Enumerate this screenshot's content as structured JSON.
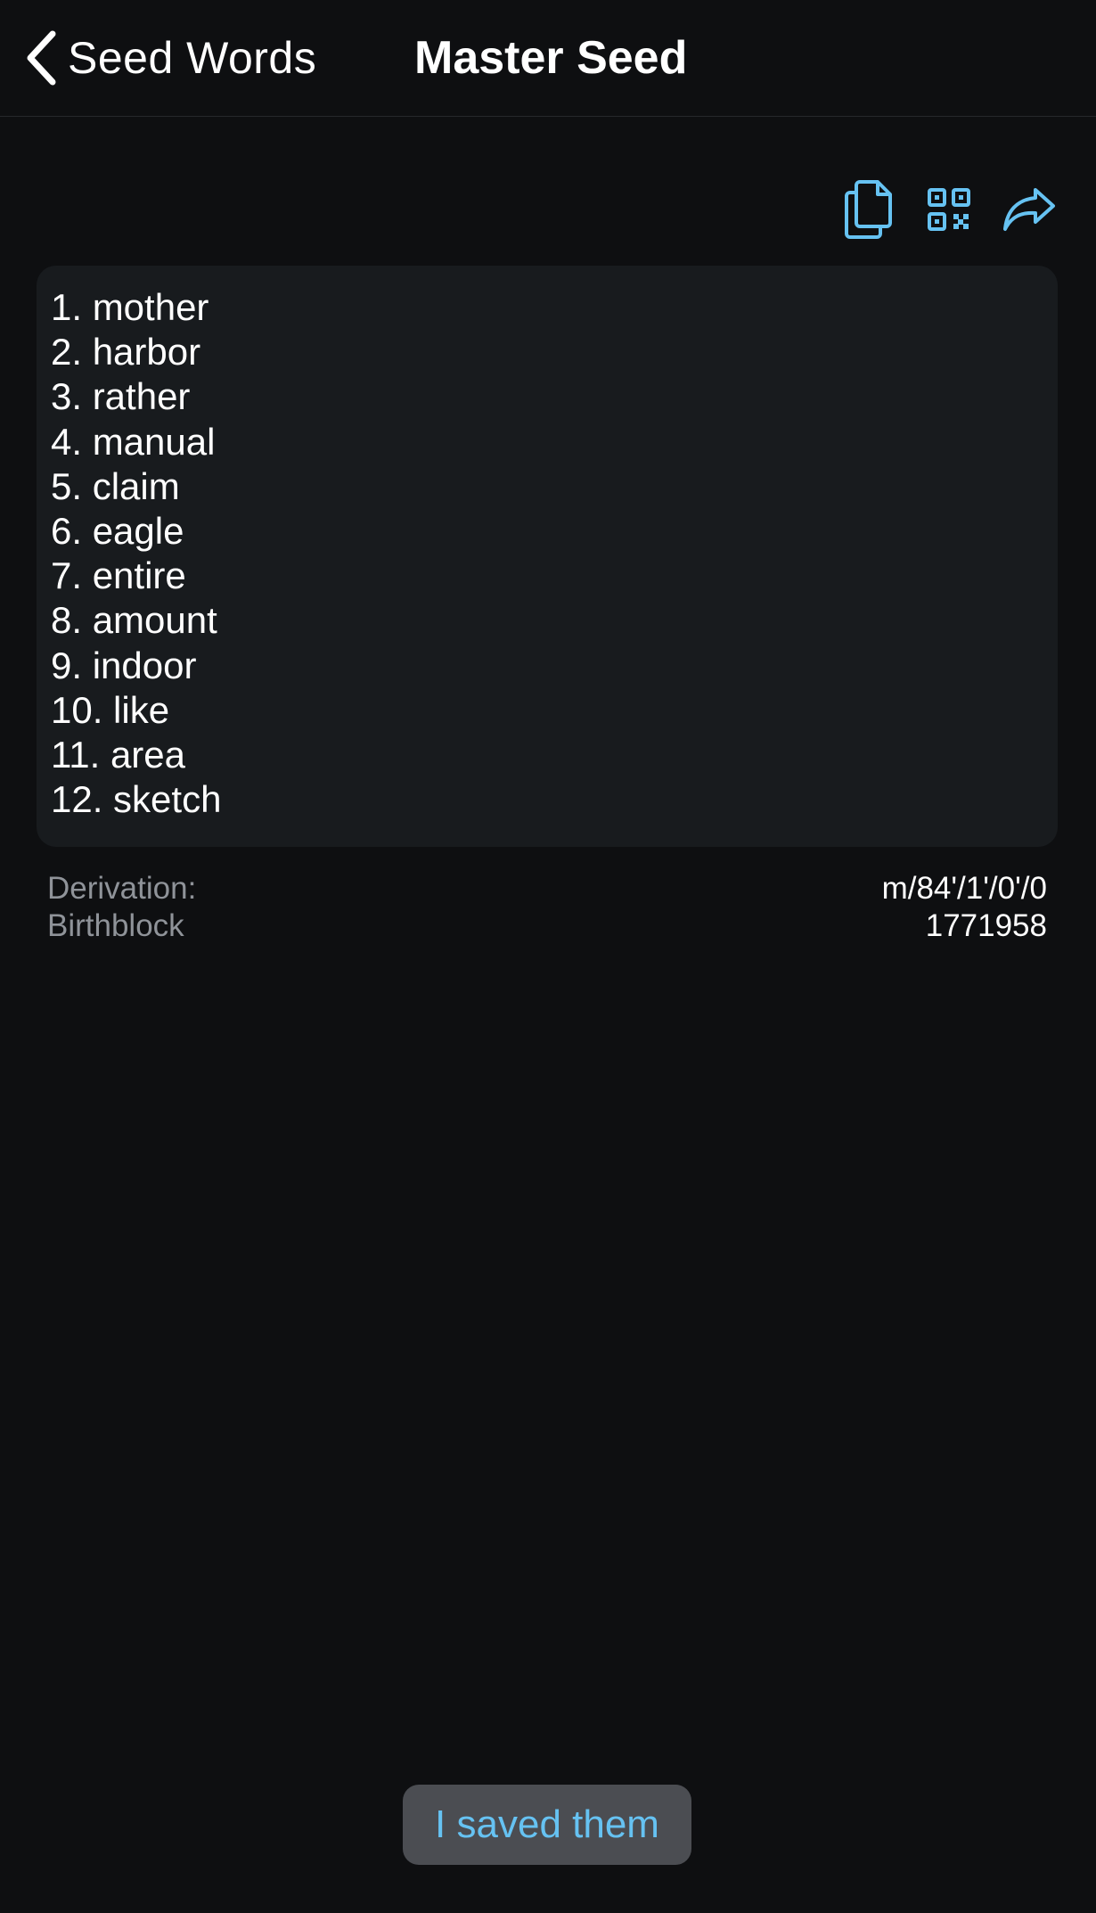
{
  "nav": {
    "back_label": "Seed Words",
    "title": "Master Seed"
  },
  "toolbar": {
    "icons": [
      "copy-icon",
      "qr-code-icon",
      "share-icon"
    ],
    "icon_color": "#66c2f2"
  },
  "words": [
    "1. mother",
    "2. harbor",
    "3. rather",
    "4. manual",
    "5. claim",
    "6. eagle",
    "7. entire",
    "8. amount",
    "9. indoor",
    "10. like",
    "11. area",
    "12. sketch"
  ],
  "meta": {
    "derivation_label": "Derivation:",
    "derivation_value": "m/84'/1'/0'/0",
    "birthblock_label": "Birthblock",
    "birthblock_value": "1771958"
  },
  "footer": {
    "saved_label": "I saved them"
  },
  "colors": {
    "background": "#0e0f11",
    "card": "#181b1e",
    "accent": "#66c2f2",
    "button_bg": "#4b4d52"
  }
}
